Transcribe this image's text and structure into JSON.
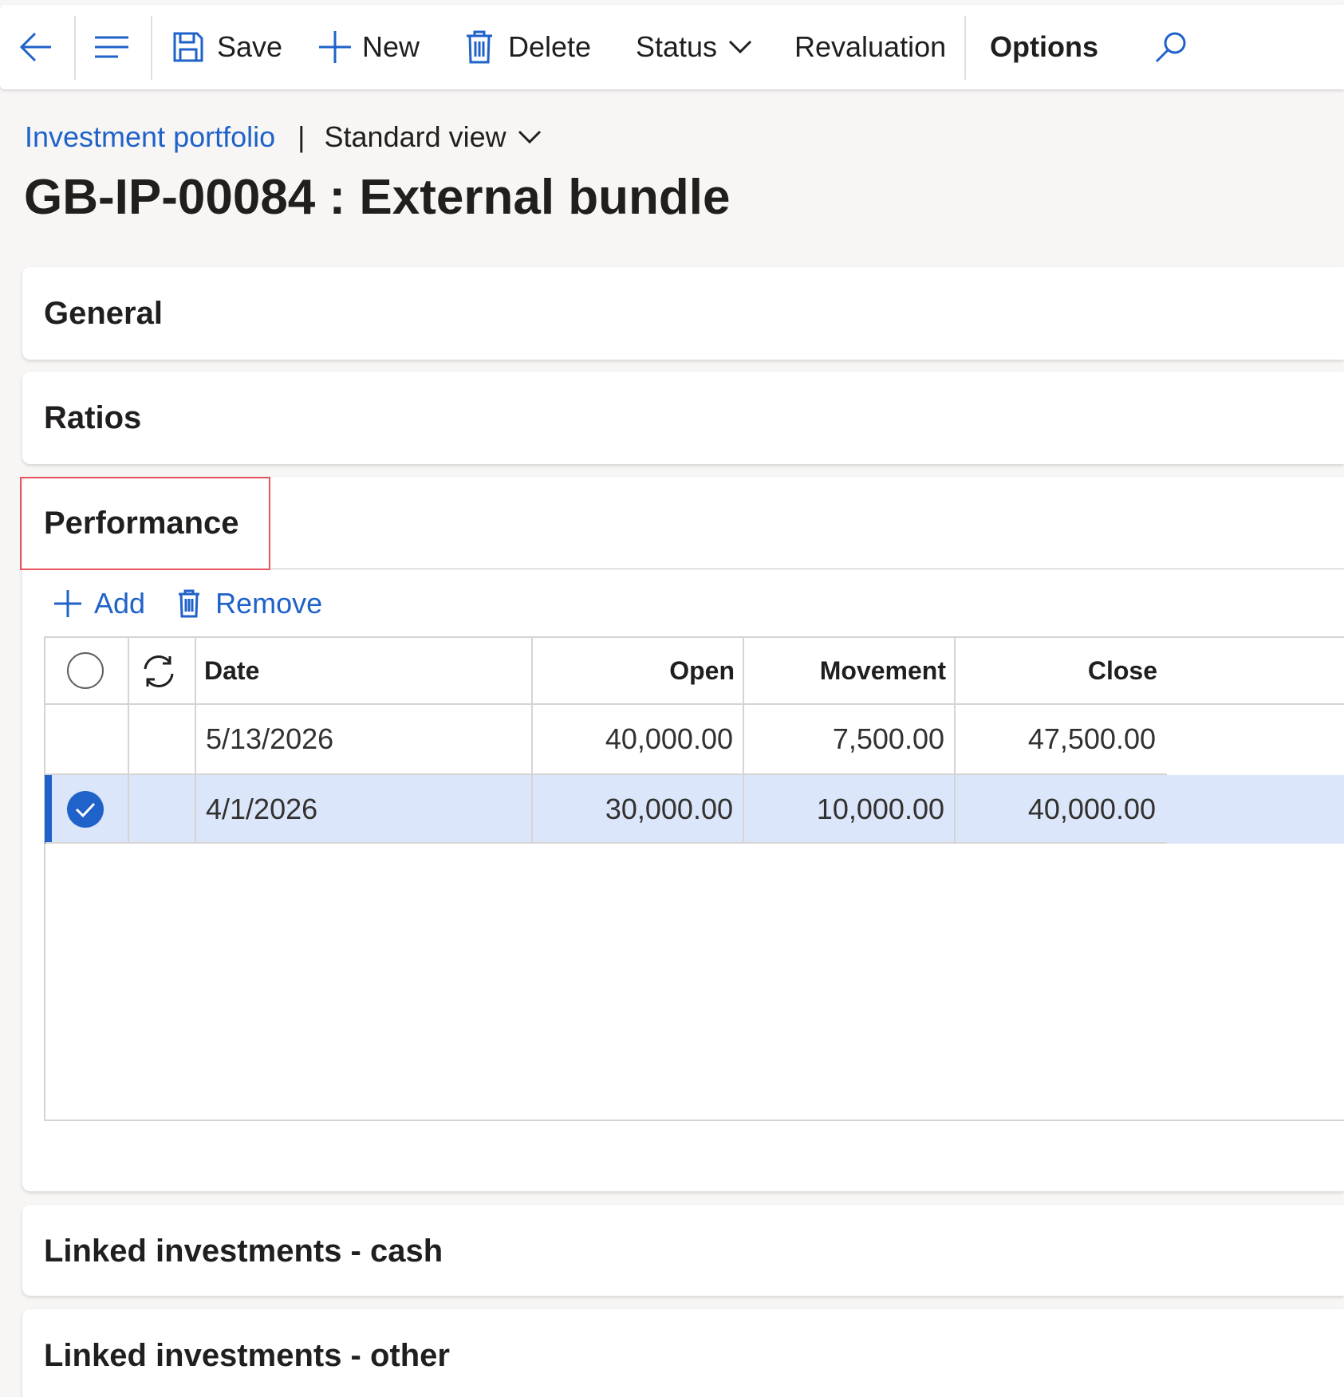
{
  "toolbar": {
    "save": "Save",
    "new": "New",
    "delete": "Delete",
    "status": "Status",
    "revaluation": "Revaluation",
    "options": "Options"
  },
  "breadcrumb": {
    "link": "Investment portfolio",
    "separator": "|",
    "view": "Standard view"
  },
  "page_title": "GB-IP-00084 : External bundle",
  "sections": {
    "general": "General",
    "ratios": "Ratios",
    "performance": "Performance",
    "linked_cash": "Linked investments - cash",
    "linked_other": "Linked investments - other"
  },
  "performance": {
    "actions": {
      "add": "Add",
      "remove": "Remove"
    },
    "columns": {
      "date": "Date",
      "open": "Open",
      "movement": "Movement",
      "close": "Close"
    },
    "rows": [
      {
        "date": "5/13/2026",
        "open": "40,000.00",
        "movement": "7,500.00",
        "close": "47,500.00",
        "selected": false
      },
      {
        "date": "4/1/2026",
        "open": "30,000.00",
        "movement": "10,000.00",
        "close": "40,000.00",
        "selected": true
      }
    ]
  },
  "colors": {
    "accent": "#1f62c9",
    "selected_row": "#dbe6fa",
    "focus_outline": "#e8545e"
  }
}
